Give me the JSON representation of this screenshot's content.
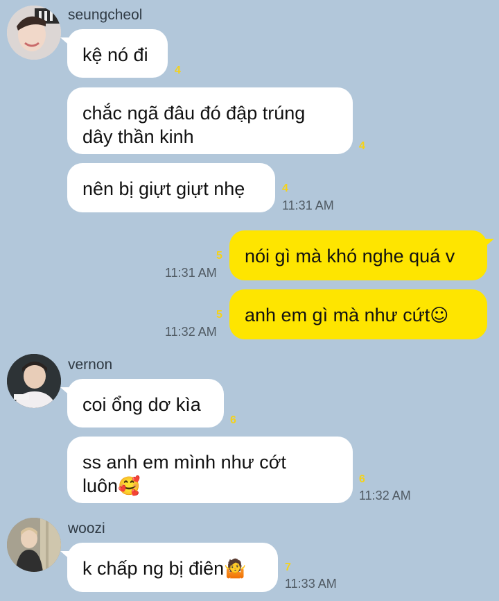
{
  "colors": {
    "background": "#b2c7da",
    "incoming": "#ffffff",
    "outgoing": "#fee500",
    "unread": "#f5d21a"
  },
  "senders": {
    "s1": {
      "name": "seungcheol",
      "avatar_icon": "profile-photo-icon"
    },
    "s2": {
      "name": "vernon",
      "avatar_icon": "profile-photo-icon"
    },
    "s3": {
      "name": "woozi",
      "avatar_icon": "profile-photo-icon"
    }
  },
  "messages": [
    {
      "from": "seungcheol",
      "text": "kệ nó đi",
      "unread": "4",
      "time": ""
    },
    {
      "from": "seungcheol",
      "line1": "chắc ngã đâu đó đập trúng",
      "line2": "dây thần kinh",
      "unread": "4",
      "time": ""
    },
    {
      "from": "seungcheol",
      "text": "nên bị giựt giựt nhẹ",
      "unread": "4",
      "time": "11:31 AM"
    },
    {
      "from": "me",
      "text": "nói gì mà khó nghe quá v",
      "unread": "5",
      "time": "11:31 AM"
    },
    {
      "from": "me",
      "text": "anh em gì mà như cứt",
      "emoji": "☺",
      "unread": "5",
      "time": "11:32 AM"
    },
    {
      "from": "vernon",
      "text": "coi ổng dơ kìa",
      "unread": "6",
      "time": ""
    },
    {
      "from": "vernon",
      "line1": "ss anh em mình như cớt",
      "line2": "luôn",
      "emoji": "🥰",
      "unread": "6",
      "time": "11:32 AM"
    },
    {
      "from": "woozi",
      "text": "k chấp ng bị điên",
      "emoji": "🤷",
      "unread": "7",
      "time": "11:33 AM"
    }
  ]
}
